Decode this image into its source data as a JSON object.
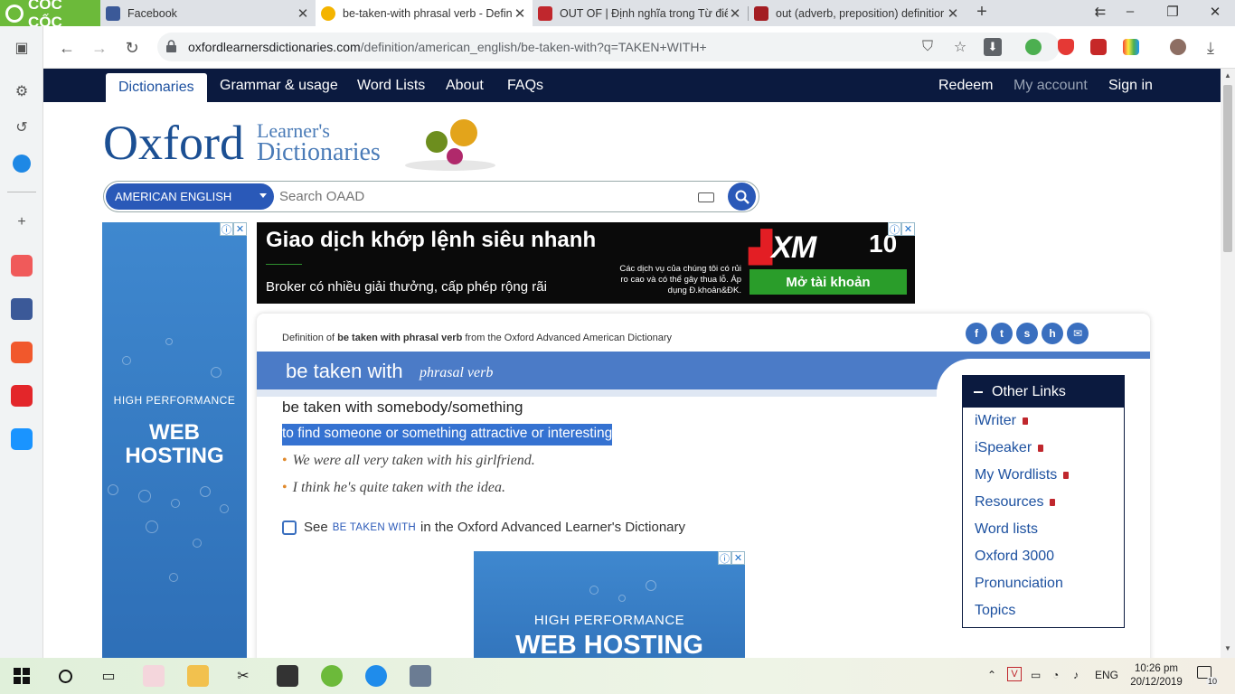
{
  "browser": {
    "brand": "CỐC CỐC",
    "tabs": [
      {
        "title": "Facebook",
        "color": "#3b5998"
      },
      {
        "title": "be-taken-with phrasal verb - Defin",
        "color": "#f4b400",
        "active": true
      },
      {
        "title": "OUT OF | Định nghĩa trong Từ điển",
        "color": "#c0272d"
      },
      {
        "title": "out (adverb, preposition) definitior",
        "color": "#a31c22"
      }
    ],
    "url_host": "oxfordlearnersdictionaries.com",
    "url_path": "/definition/american_english/be-taken-with?q=TAKEN+WITH+"
  },
  "site_nav": {
    "tabs": [
      "Dictionaries",
      "Grammar & usage",
      "Word Lists",
      "About",
      "FAQs"
    ],
    "right": [
      "Redeem",
      "My account",
      "Sign in"
    ]
  },
  "logo": {
    "main": "Oxford",
    "line1": "Learner's",
    "line2": "Dictionaries"
  },
  "search": {
    "dialect": "AMERICAN ENGLISH",
    "placeholder": "Search OAAD"
  },
  "left_ad": {
    "line1": "HIGH PERFORMANCE",
    "line2": "WEB HOSTING"
  },
  "top_ad": {
    "headline": "Giao dịch khớp lệnh siêu nhanh",
    "subline": "Broker có nhiều giải thưởng, cấp phép rộng rãi",
    "brand": "XM",
    "badge": "10",
    "disclaimer": "Các dịch vụ của chúng tôi có rủi ro cao và có thể gây thua lỗ. Áp dụng Đ.khoản&ĐK.",
    "cta": "Mở tài khoản"
  },
  "entry": {
    "crumb_prefix": "Definition of ",
    "crumb_bold": "be taken with phrasal verb",
    "crumb_suffix": " from the Oxford Advanced American Dictionary",
    "headword": "be taken with",
    "pos": "phrasal verb",
    "sense_head": "be taken with somebody/something",
    "definition": "to find someone or something attractive or interesting",
    "examples": [
      "We were all very taken with his girlfriend.",
      "I think he's quite taken with the idea."
    ],
    "see_prefix": "See",
    "see_xref": "BE TAKEN WITH",
    "see_suffix": "in the Oxford Advanced Learner's Dictionary"
  },
  "inline_ad": {
    "line1": "HIGH PERFORMANCE",
    "line2": "WEB HOSTING"
  },
  "other_links": {
    "title": "Other Links",
    "items": [
      {
        "label": "iWriter",
        "locked": true
      },
      {
        "label": "iSpeaker",
        "locked": true
      },
      {
        "label": "My Wordlists",
        "locked": true
      },
      {
        "label": "Resources",
        "locked": true
      },
      {
        "label": "Word lists",
        "locked": false
      },
      {
        "label": "Oxford 3000",
        "locked": false
      },
      {
        "label": "Pronunciation",
        "locked": false
      },
      {
        "label": "Topics",
        "locked": false
      }
    ]
  },
  "taskbar": {
    "lang": "ENG",
    "time": "10:26 pm",
    "date": "20/12/2019",
    "notifications": "10"
  },
  "colors": {
    "oxford_navy": "#0b1a3f",
    "oxford_blue": "#2a59b8",
    "band_blue": "#4b7bc7",
    "coccoc_green": "#6cba3a"
  }
}
